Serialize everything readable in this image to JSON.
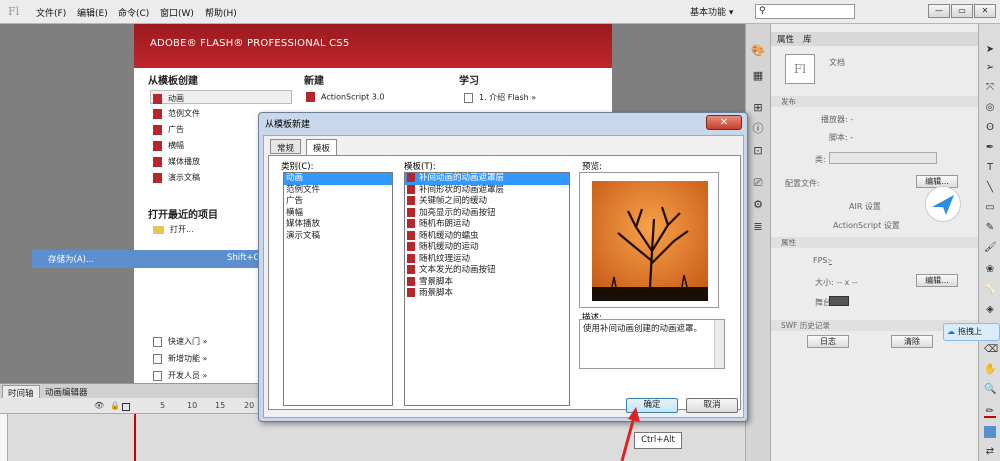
{
  "menubar": {
    "logo": "Fl",
    "items": [
      "文件(F)",
      "编辑(E)",
      "命令(C)",
      "窗口(W)",
      "帮助(H)"
    ],
    "workspace": "基本功能 ▾",
    "window_buttons": [
      "—",
      "▭",
      "✕"
    ]
  },
  "welcome": {
    "title": "ADOBE® FLASH® PROFESSIONAL CS5",
    "from_template": {
      "heading": "从模板创建",
      "items": [
        "动画",
        "范例文件",
        "广告",
        "横幅",
        "媒体播放",
        "演示文稿"
      ]
    },
    "new": {
      "heading": "新建",
      "items": [
        "ActionScript 3.0"
      ]
    },
    "learn": {
      "heading": "学习",
      "items": [
        "1. 介绍 Flash »"
      ]
    },
    "recent": {
      "heading": "打开最近的项目",
      "open": "打开..."
    },
    "links": [
      "快速入门 »",
      "新增功能 »",
      "开发人员 »"
    ]
  },
  "context_menu": {
    "label": "存储为(A)...",
    "shortcut": "Shift+Ctrl+S"
  },
  "timeline": {
    "tabs": [
      "时间轴",
      "动画编辑器"
    ],
    "ticks": [
      "5",
      "10",
      "15",
      "20"
    ]
  },
  "properties": {
    "tabs": [
      "属性",
      "库"
    ],
    "doc_label": "文档",
    "sections": {
      "publish": "发布",
      "props": "属性",
      "swf": "SWF 历史记录"
    },
    "rows": {
      "player": "播放器: -",
      "script": "脚本: -",
      "class": "类:",
      "profile": "配置文件:",
      "air": "AIR 设置",
      "as": "ActionScript 设置",
      "fps": "FPS:",
      "fps_val": "-",
      "size": "大小: -- x --",
      "stage": "舞台:"
    },
    "buttons": {
      "edit": "编辑...",
      "log": "日志",
      "clear": "清除"
    }
  },
  "dialog": {
    "title": "从模板新建",
    "close": "✕",
    "tabs": [
      "常规",
      "模板"
    ],
    "category_label": "类别(C):",
    "categories": [
      "动画",
      "范例文件",
      "广告",
      "横幅",
      "媒体播放",
      "演示文稿"
    ],
    "template_label": "模板(T):",
    "templates": [
      "补间动画的动画遮罩层",
      "补间形状的动画遮罩层",
      "关键帧之间的缓动",
      "加亮显示的动画按钮",
      "随机布朗运动",
      "随机缓动的蠕虫",
      "随机缓动的运动",
      "随机纹理运动",
      "文本发光的动画按钮",
      "雪景脚本",
      "雨景脚本"
    ],
    "preview_label": "预览:",
    "desc_label": "描述:",
    "description": "使用补间动画创建的动画遮罩。",
    "ok": "确定",
    "cancel": "取消"
  },
  "tooltip": "Ctrl+Alt",
  "cloud_tag": "拖拽上",
  "colors": {
    "accent_red": "#b7262b",
    "selection": "#3399ff"
  }
}
